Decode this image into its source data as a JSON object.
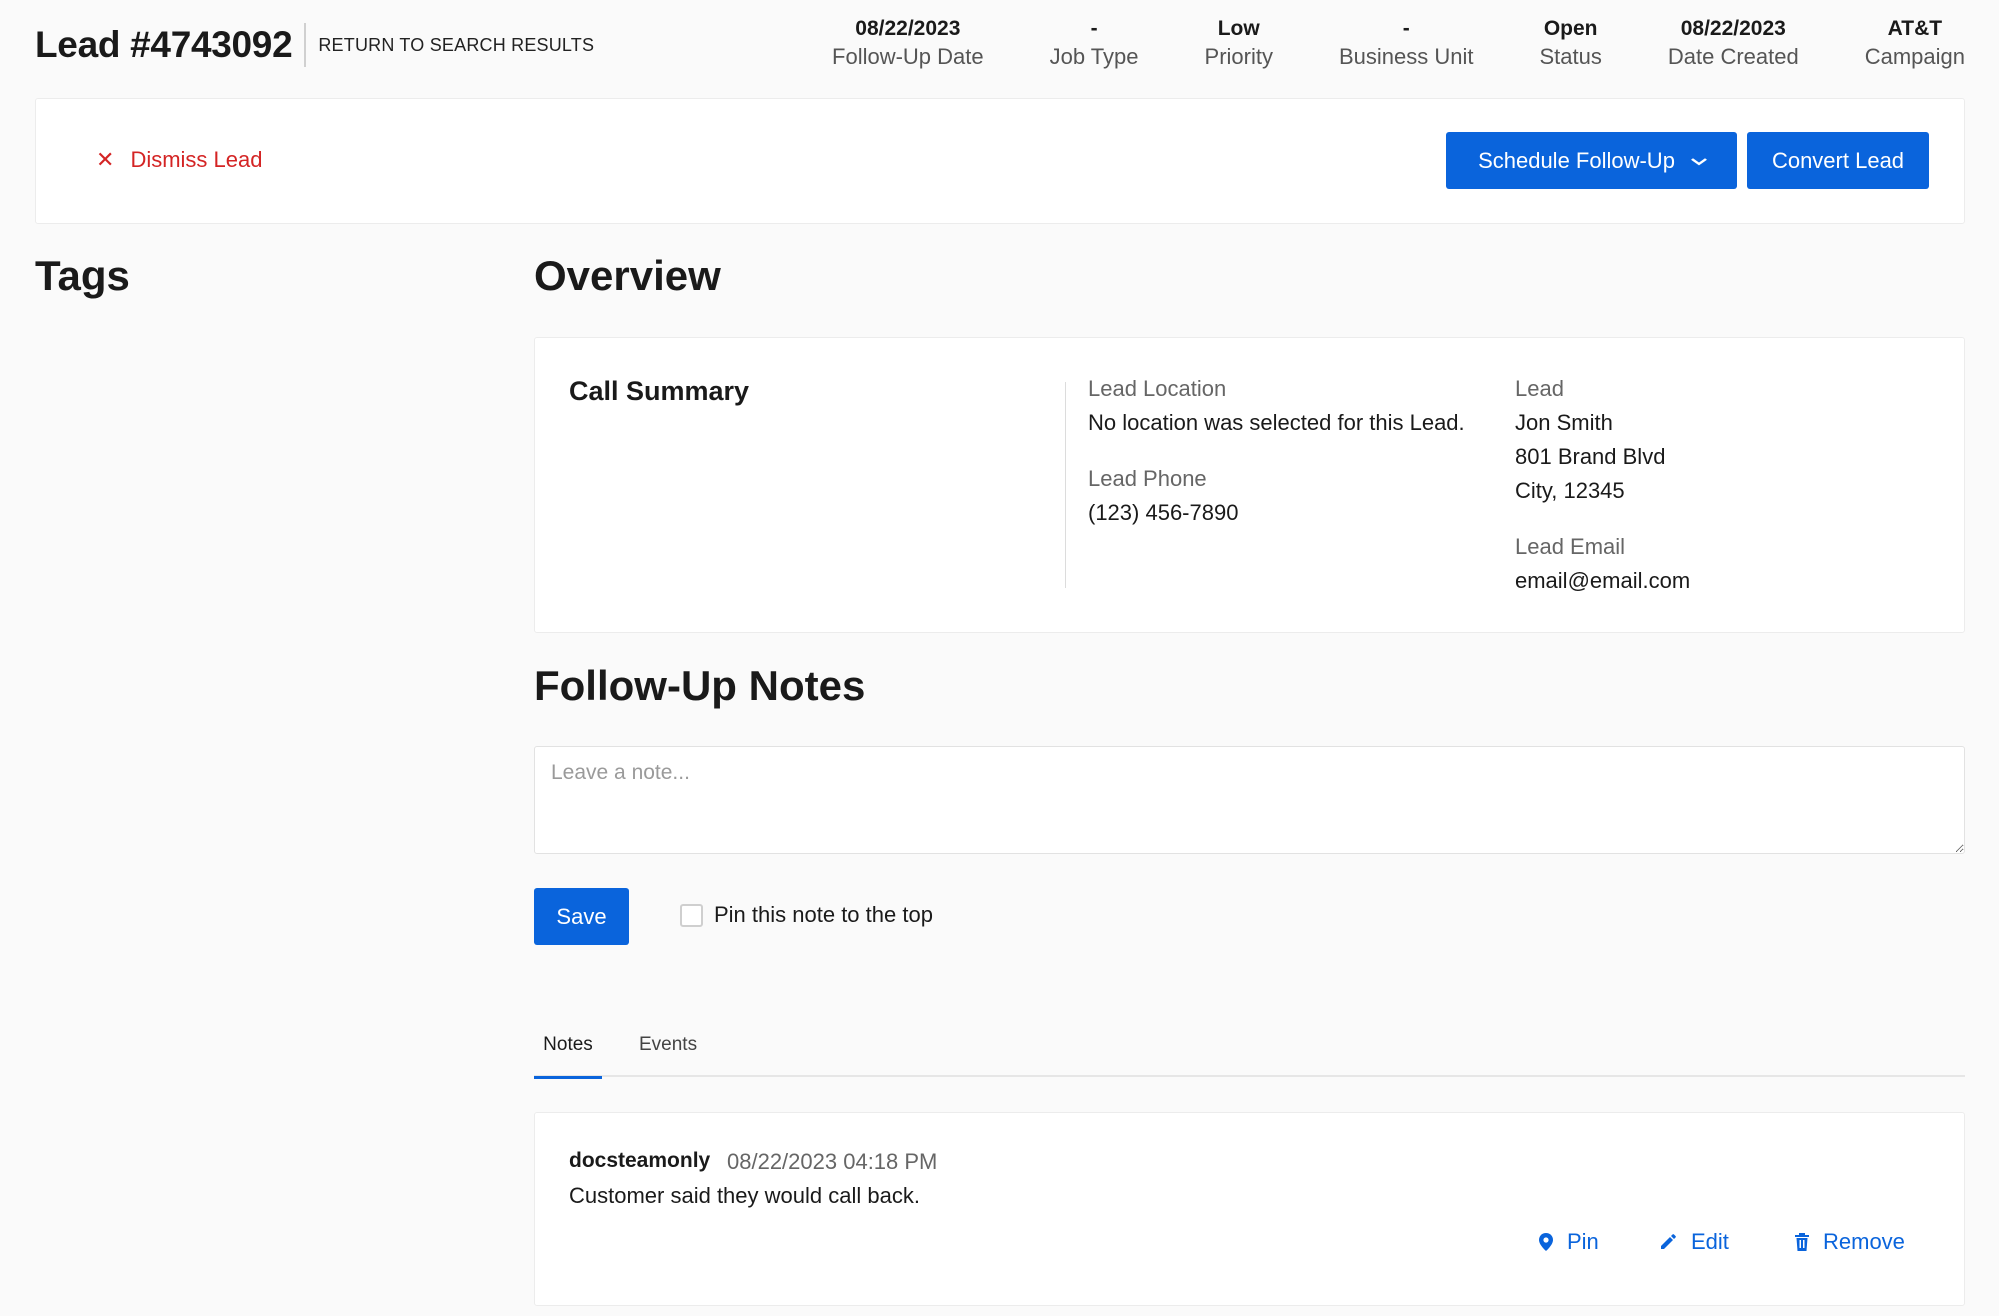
{
  "header": {
    "title": "Lead #4743092",
    "return_link": "RETURN TO SEARCH RESULTS",
    "stats": [
      {
        "value": "08/22/2023",
        "label": "Follow-Up Date"
      },
      {
        "value": "-",
        "label": "Job Type"
      },
      {
        "value": "Low",
        "label": "Priority"
      },
      {
        "value": "-",
        "label": "Business Unit"
      },
      {
        "value": "Open",
        "label": "Status"
      },
      {
        "value": "08/22/2023",
        "label": "Date Created"
      },
      {
        "value": "AT&T",
        "label": "Campaign"
      }
    ]
  },
  "actions": {
    "dismiss_label": "Dismiss Lead",
    "schedule_label": "Schedule Follow-Up",
    "convert_label": "Convert Lead"
  },
  "sections": {
    "tags_title": "Tags",
    "overview_title": "Overview",
    "followup_title": "Follow-Up Notes"
  },
  "overview": {
    "call_summary_title": "Call Summary",
    "lead_location_label": "Lead Location",
    "lead_location_value": "No location was selected for this Lead.",
    "lead_phone_label": "Lead Phone",
    "lead_phone_value": "(123) 456-7890",
    "lead_label": "Lead",
    "lead_name": "Jon Smith",
    "lead_address_line1": "801 Brand Blvd",
    "lead_address_line2": "City, 12345",
    "lead_email_label": "Lead Email",
    "lead_email_value": "email@email.com"
  },
  "notes_form": {
    "placeholder": "Leave a note...",
    "save_label": "Save",
    "pin_label": "Pin this note to the top"
  },
  "tabs": [
    {
      "label": "Notes",
      "active": true
    },
    {
      "label": "Events",
      "active": false
    }
  ],
  "note": {
    "author": "docsteamonly",
    "timestamp": "08/22/2023 04:18 PM",
    "body": "Customer said they would call back.",
    "pin_label": "Pin",
    "edit_label": "Edit",
    "remove_label": "Remove"
  },
  "colors": {
    "accent": "#0a64dc",
    "danger": "#d42424",
    "background": "#fafafa"
  }
}
